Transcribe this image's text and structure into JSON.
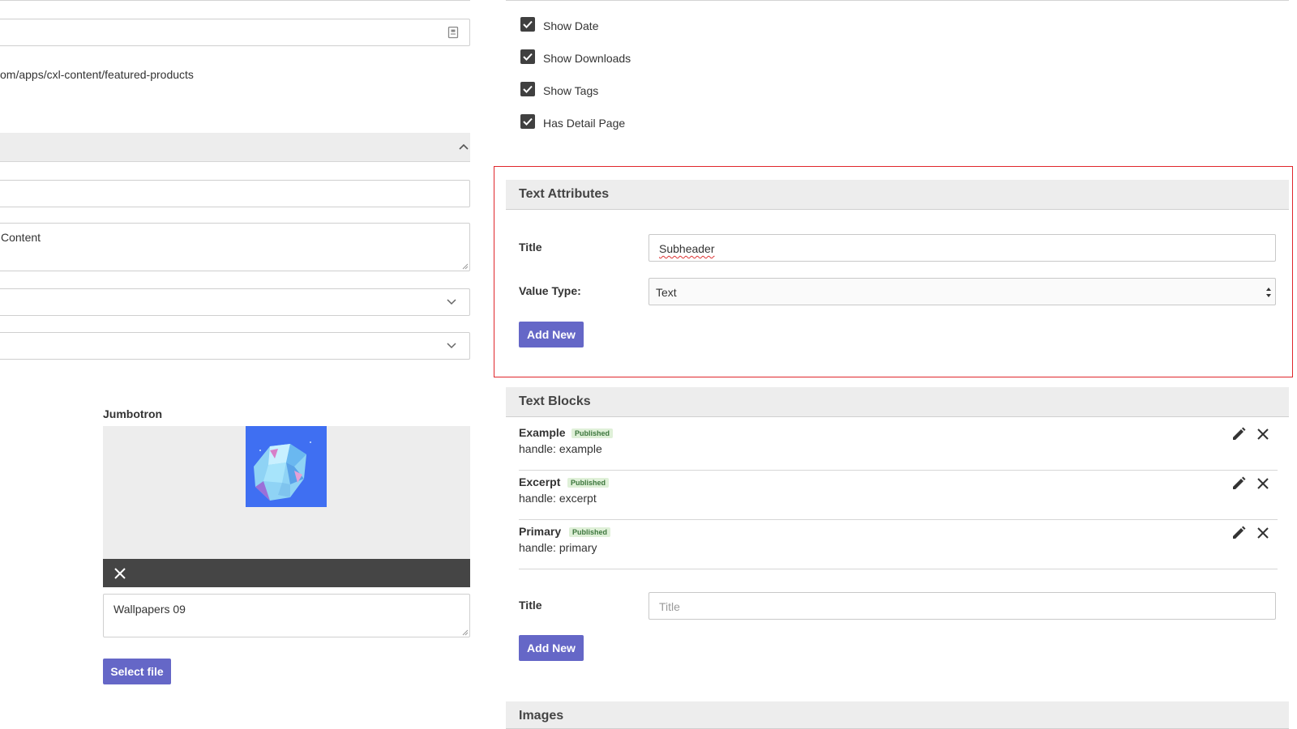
{
  "left": {
    "url_path": "om/apps/cxl-content/featured-products",
    "textarea_value": "Content",
    "jumbotron": {
      "label": "Jumbotron",
      "caption": "Wallpapers 09",
      "select_file_label": "Select file"
    }
  },
  "right": {
    "checkboxes": [
      {
        "label": "Show Date",
        "checked": true
      },
      {
        "label": "Show Downloads",
        "checked": true
      },
      {
        "label": "Show Tags",
        "checked": true
      },
      {
        "label": "Has Detail Page",
        "checked": true
      }
    ],
    "text_attributes": {
      "heading": "Text Attributes",
      "title_label": "Title",
      "title_value": "Subheader",
      "value_type_label": "Value Type:",
      "value_type_selected": "Text",
      "add_new_label": "Add New"
    },
    "text_blocks": {
      "heading": "Text Blocks",
      "items": [
        {
          "name": "Example",
          "status": "Published",
          "handle": "handle: example"
        },
        {
          "name": "Excerpt",
          "status": "Published",
          "handle": "handle: excerpt"
        },
        {
          "name": "Primary",
          "status": "Published",
          "handle": "handle: primary"
        }
      ],
      "title_label": "Title",
      "title_placeholder": "Title",
      "add_new_label": "Add New"
    },
    "images": {
      "heading": "Images"
    }
  },
  "colors": {
    "accent_button": "#6567c7",
    "highlight_border": "#e0262b",
    "badge_bg": "#dff0d8",
    "badge_text": "#3c763d",
    "image_bg": "#3f6ff2"
  }
}
